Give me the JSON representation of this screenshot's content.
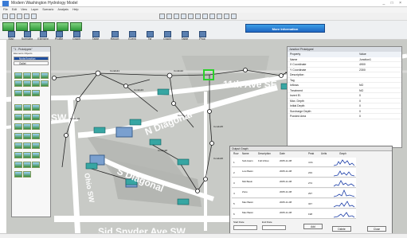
{
  "window": {
    "title": "Modern Washington Hydrology Model",
    "controls": "_ □ ×"
  },
  "menu": [
    "File",
    "Edit",
    "View",
    "Layer",
    "Scenario",
    "Analysis",
    "Help"
  ],
  "toolbar": {
    "more_info_label": "More Information",
    "buttons": [
      "Map",
      "Scenario",
      "Element",
      "Profile",
      "Graph",
      "Table",
      "Report",
      "Event",
      "Tsf",
      "Graph",
      "Table",
      "Prop"
    ]
  },
  "map": {
    "streets": [
      "SW",
      "N Diagonal",
      "11th Ave SE",
      "S Diagonal",
      "Sid Snvder Ave SW",
      "Ohio SW"
    ],
    "marker": "21"
  },
  "prototypes": {
    "title": "\"1 - Prototypes\"",
    "tabs": "Elements   Objects",
    "items": [
      "Node/Junction",
      "Outlet"
    ]
  },
  "properties": {
    "title": "Junction 'Prototypes'",
    "header": {
      "key": "Property",
      "value": "Value"
    },
    "rows": [
      {
        "k": "Name",
        "v": "Junction1"
      },
      {
        "k": "X Coordinate",
        "v": "4900"
      },
      {
        "k": "Y Coordinate",
        "v": "2300"
      },
      {
        "k": "Description",
        "v": ""
      },
      {
        "k": "Tag",
        "v": ""
      },
      {
        "k": "Inflows",
        "v": "NO"
      },
      {
        "k": "Treatment",
        "v": "NO"
      },
      {
        "k": "Invert El.",
        "v": "0"
      },
      {
        "k": "Max. Depth",
        "v": "0"
      },
      {
        "k": "Initial Depth",
        "v": "0"
      },
      {
        "k": "Surcharge Depth",
        "v": "0"
      },
      {
        "k": "Ponded Area",
        "v": "0"
      }
    ]
  },
  "graphs": {
    "title": "Output Graph",
    "columns": [
      "Row",
      "Name",
      "Description",
      "Date",
      "Peak",
      "Units",
      "Graph"
    ],
    "rows": [
      {
        "n": "1",
        "name": "Sub-basin",
        "desc": "Full Inflow",
        "date": "2005-11-08",
        "peak": "4.01"
      },
      {
        "n": "2",
        "name": "Low Basin",
        "desc": "",
        "date": "2005-11-08",
        "peak": "233"
      },
      {
        "n": "3",
        "name": "Mid Basin",
        "desc": "",
        "date": "2005-11-08",
        "peak": "274"
      },
      {
        "n": "4",
        "name": "Zone",
        "desc": "",
        "date": "2005-11-08",
        "peak": "297"
      },
      {
        "n": "5",
        "name": "Max Basin",
        "desc": "",
        "date": "2005-11-08",
        "peak": "347"
      },
      {
        "n": "6",
        "name": "Max Basin",
        "desc": "",
        "date": "2005-11-08",
        "peak": "198"
      }
    ],
    "filter_labels": {
      "start": "Start Date",
      "end": "End Date"
    },
    "buttons": {
      "add": "Add",
      "delete": "Delete",
      "close": "Close"
    }
  }
}
